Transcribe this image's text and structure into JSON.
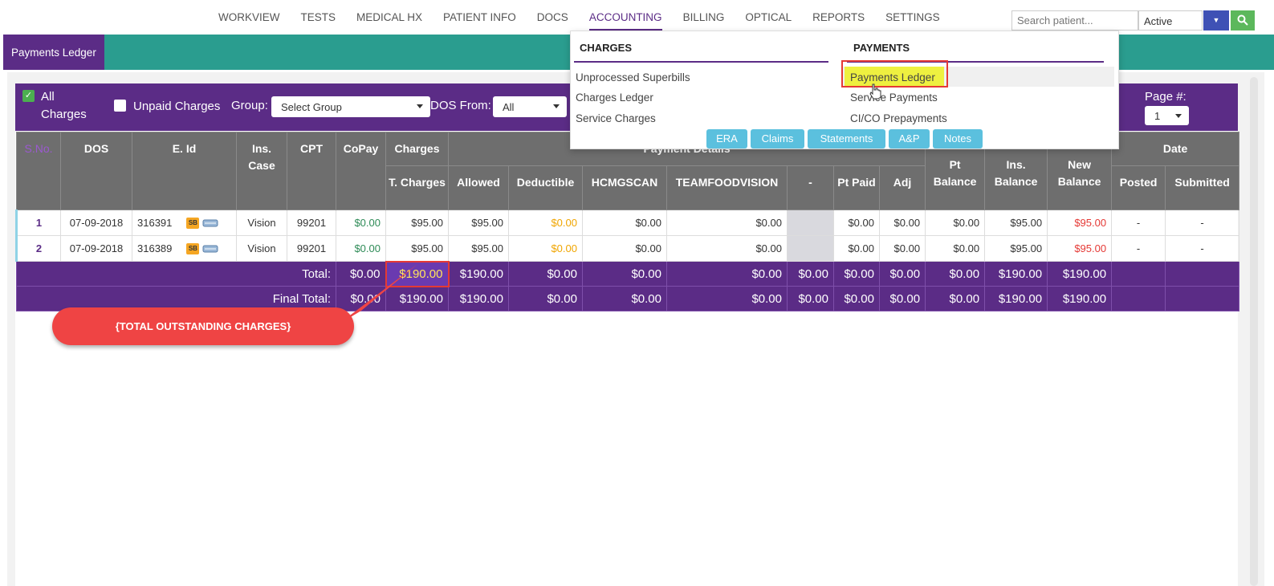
{
  "nav": {
    "items": [
      "WORKVIEW",
      "TESTS",
      "MEDICAL HX",
      "PATIENT INFO",
      "DOCS",
      "ACCOUNTING",
      "BILLING",
      "OPTICAL",
      "REPORTS",
      "SETTINGS"
    ],
    "active": "ACCOUNTING",
    "search_placeholder": "Search patient...",
    "status_value": "Active"
  },
  "tab": {
    "label": "Payments Ledger"
  },
  "filters": {
    "all_label": "All",
    "charges_label": "Charges",
    "unpaid_label": "Unpaid Charges",
    "group_label": "Group:",
    "group_value": "Select Group",
    "dos_label": "DOS From:",
    "dos_value": "All",
    "page_label": "Page #:",
    "page_value": "1"
  },
  "table": {
    "h": {
      "sno": "S.No.",
      "dos": "DOS",
      "eid": "E. Id",
      "inscase": "Ins. Case",
      "cpt": "CPT",
      "copay": "CoPay",
      "charges": "Charges",
      "paydet": "Payment Details",
      "ptbal": "Pt Balance",
      "insbal": "Ins. Balance",
      "newbal": "New Balance",
      "date": "Date",
      "tcharges": "T. Charges",
      "allowed": "Allowed",
      "deductible": "Deductible",
      "hcmg": "HCMGSCAN",
      "teamfood": "TEAMFOODVISION",
      "dash": "-",
      "ptpaid": "Pt Paid",
      "adj": "Adj",
      "posted": "Posted",
      "submitted": "Submitted"
    },
    "rows": [
      {
        "sno": "1",
        "dos": "07-09-2018",
        "eid": "316391",
        "badge": "SB",
        "inscase": "Vision",
        "cpt": "99201",
        "copay": "$0.00",
        "tcharges": "$95.00",
        "allowed": "$95.00",
        "deductible": "$0.00",
        "hcmg": "$0.00",
        "teamfood": "$0.00",
        "ptpaid": "$0.00",
        "adj": "$0.00",
        "ptbal": "$0.00",
        "insbal": "$95.00",
        "newbal": "$95.00",
        "posted": "-",
        "submitted": "-"
      },
      {
        "sno": "2",
        "dos": "07-09-2018",
        "eid": "316389",
        "badge": "SB",
        "inscase": "Vision",
        "cpt": "99201",
        "copay": "$0.00",
        "tcharges": "$95.00",
        "allowed": "$95.00",
        "deductible": "$0.00",
        "hcmg": "$0.00",
        "teamfood": "$0.00",
        "ptpaid": "$0.00",
        "adj": "$0.00",
        "ptbal": "$0.00",
        "insbal": "$95.00",
        "newbal": "$95.00",
        "posted": "-",
        "submitted": "-"
      }
    ],
    "total": {
      "label": "Total:",
      "copay": "$0.00",
      "tcharges": "$190.00",
      "allowed": "$190.00",
      "deductible": "$0.00",
      "hcmg": "$0.00",
      "teamfood": "$0.00",
      "dash": "$0.00",
      "ptpaid": "$0.00",
      "adj": "$0.00",
      "ptbal": "$0.00",
      "insbal": "$190.00",
      "newbal": "$190.00"
    },
    "final": {
      "label": "Final Total:",
      "copay": "$0.00",
      "tcharges": "$190.00",
      "allowed": "$190.00",
      "deductible": "$0.00",
      "hcmg": "$0.00",
      "teamfood": "$0.00",
      "dash": "$0.00",
      "ptpaid": "$0.00",
      "adj": "$0.00",
      "ptbal": "$0.00",
      "insbal": "$190.00",
      "newbal": "$190.00"
    }
  },
  "menu": {
    "charges_header": "CHARGES",
    "payments_header": "PAYMENTS",
    "charges_items": [
      "Unprocessed Superbills",
      "Charges Ledger",
      "Service Charges"
    ],
    "payments_items": [
      "Payments Ledger",
      "Service Payments",
      "CI/CO Prepayments"
    ],
    "buttons": [
      "ERA",
      "Claims",
      "Statements",
      "A&P",
      "Notes"
    ]
  },
  "callout": {
    "text": "{TOTAL OUTSTANDING CHARGES}"
  },
  "colors": {
    "purple": "#5b2c86",
    "teal": "#2a9d8f",
    "header_gray": "#6e6e6e",
    "highlight": "#e53935"
  }
}
